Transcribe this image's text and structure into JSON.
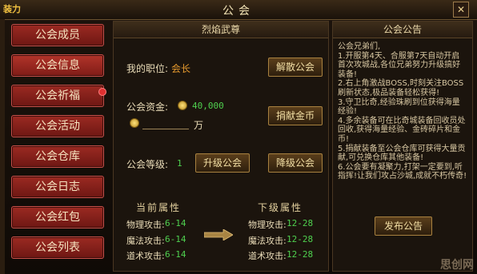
{
  "window": {
    "title": "公会",
    "corner_logo": "装力",
    "close_glyph": "✕"
  },
  "sidebar": {
    "items": [
      {
        "label": "公会成员"
      },
      {
        "label": "公会信息"
      },
      {
        "label": "公会祈福"
      },
      {
        "label": "公会活动"
      },
      {
        "label": "公会仓库"
      },
      {
        "label": "公会日志"
      },
      {
        "label": "公会红包"
      },
      {
        "label": "公会列表"
      }
    ]
  },
  "guild": {
    "name": "烈焰武尊",
    "position_label": "我的职位:",
    "position_value": "会长",
    "funds_label": "公会资金:",
    "funds_value": "40,000",
    "donate_unit": "万",
    "level_label": "公会等级:",
    "level_value": "1",
    "buttons": {
      "disband": "解散公会",
      "donate": "捐献金币",
      "upgrade": "升级公会",
      "downgrade": "降级公会"
    }
  },
  "attributes": {
    "current_title": "当前属性",
    "next_title": "下级属性",
    "current": [
      {
        "label": "物理攻击:",
        "value": "6-14"
      },
      {
        "label": "魔法攻击:",
        "value": "6-14"
      },
      {
        "label": "道术攻击:",
        "value": "6-14"
      }
    ],
    "next": [
      {
        "label": "物理攻击:",
        "value": "12-28"
      },
      {
        "label": "魔法攻击:",
        "value": "12-28"
      },
      {
        "label": "道术攻击:",
        "value": "12-28"
      }
    ]
  },
  "notice": {
    "title": "公会公告",
    "lines": [
      "公会兄弟们,",
      "1.开服第4天、合服第7天自动开启首次攻城战,各位兄弟努力升级搞好装备!",
      "2.右上角激战BOSS,时刻关注BOSS刷新状态,极品装备轻松获得!",
      "3.守卫比奇,经验珠刷到位获得海量经验!",
      "4.多余装备可在比奇城装备回收员处回收,获得海量经验、金砖碎片和金币!",
      "5.捐献装备至公会仓库可获得大量贡献,可兑换仓库其他装备!",
      "6.公会要有凝聚力,打架一定要到,听指挥!让我们攻占沙城,成就不朽传奇!"
    ],
    "publish_button": "发布公告"
  },
  "watermark": "思创网",
  "colors": {
    "accent": "#e69a2e",
    "green": "#4fd04f",
    "red_button": "#8a2019"
  }
}
